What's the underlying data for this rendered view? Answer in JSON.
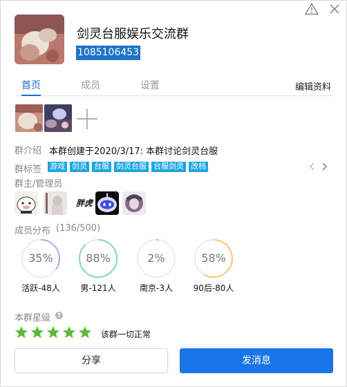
{
  "header": {
    "group_name": "剑灵台服娱乐交流群",
    "group_id": "1085106453"
  },
  "tabs": [
    {
      "label": "首页",
      "active": true
    },
    {
      "label": "成员",
      "active": false
    },
    {
      "label": "设置",
      "active": false
    }
  ],
  "edit_label": "编辑资料",
  "intro": {
    "label": "群介绍",
    "text": "本群创建于2020/3/17:  本群讨论剑灵台服"
  },
  "tags": {
    "label": "群标签",
    "items": [
      "游戏",
      "剑灵",
      "台服",
      "剑灵台服",
      "台服剑灵",
      "改档"
    ]
  },
  "admins": {
    "label": "群主/管理员",
    "text_avatar": "胖虎"
  },
  "members": {
    "label": "成员分布",
    "count": "(136/500)",
    "stats": [
      {
        "value": "35%",
        "fraction": 0.35,
        "label": "活跃-48人",
        "color": "#b7a3e6"
      },
      {
        "value": "88%",
        "fraction": 0.88,
        "label": "男-121人",
        "color": "#7fd9b8"
      },
      {
        "value": "2%",
        "fraction": 0.02,
        "label": "南京-3人",
        "color": "#8ec9ee"
      },
      {
        "value": "58%",
        "fraction": 0.58,
        "label": "90后-80人",
        "color": "#f5c872"
      }
    ]
  },
  "rating": {
    "label": "本群星级",
    "stars": 5,
    "text": "该群一切正常",
    "star_color": "#5dbb3a"
  },
  "buttons": {
    "share": "分享",
    "send": "发消息"
  }
}
